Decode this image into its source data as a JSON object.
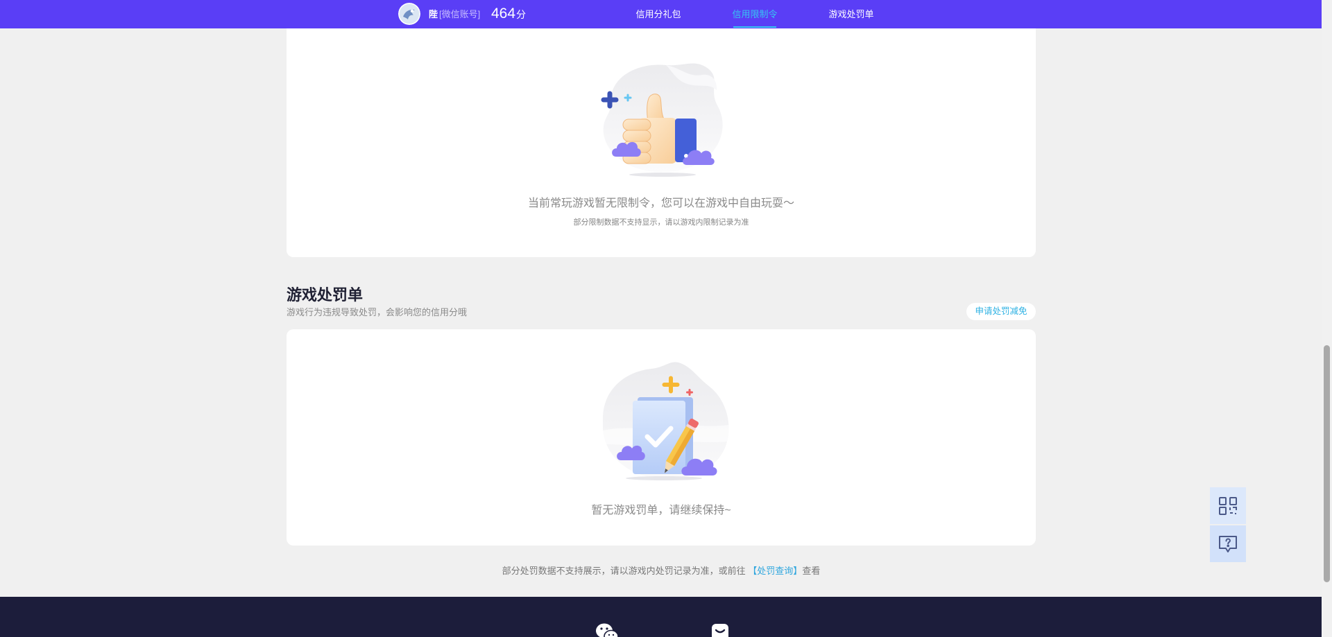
{
  "colors": {
    "nav_bg": "#5a3ef6",
    "accent": "#36c6f2",
    "link": "#2ea6de",
    "footer_bg": "#1c1d3b",
    "page_bg": "#f0f0f0"
  },
  "nav": {
    "avatar_icon": "avatar-image",
    "username": "陛",
    "account_type": "[微信账号]",
    "score": "464",
    "score_unit": "分",
    "links": [
      {
        "label": "信用分礼包"
      },
      {
        "label": "信用限制令",
        "active": true
      },
      {
        "label": "游戏处罚单"
      }
    ]
  },
  "restriction_section": {
    "illustration_icon": "thumbs-up-illustration",
    "empty_message": "当前常玩游戏暂无限制令，您可以在游戏中自由玩耍～",
    "note": "部分限制数据不支持显示，请以游戏内限制记录为准"
  },
  "penalty_section": {
    "title": "游戏处罚单",
    "subtitle": "游戏行为违规导致处罚，会影响您的信用分哦",
    "appeal_button": "申请处罚减免",
    "illustration_icon": "document-check-illustration",
    "empty_message": "暂无游戏罚单，请继续保持~",
    "footer_note": {
      "prefix": "部分处罚数据不支持展示，请以游戏内处罚记录为准，或前往 ",
      "link": "【处罚查询】",
      "suffix": "查看"
    }
  },
  "float_buttons": [
    {
      "icon": "qr-code-icon"
    },
    {
      "icon": "help-chat-icon"
    }
  ],
  "footer": {
    "icons": [
      "wechat-icon",
      "smile-box-icon"
    ]
  }
}
